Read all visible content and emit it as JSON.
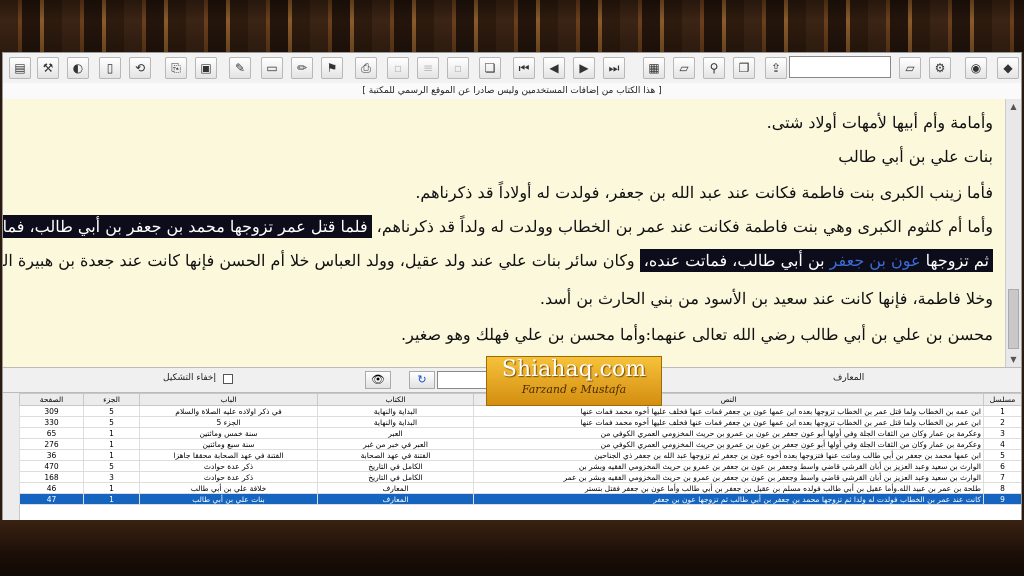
{
  "notice": "[ هذا الكتاب من إضافات المستخدمين وليس صادرا عن الموقع الرسمي للمكتبة ]",
  "toolbar": {
    "icons": [
      "app-icon",
      "tools-icon",
      "eraser-icon",
      "page-icon",
      "refresh-icon",
      "copy-icon",
      "paste-icon",
      "edit-icon",
      "note-icon",
      "pencil-icon",
      "tag-icon",
      "print-icon",
      "disabled-icon-1",
      "disabled-icon-2",
      "disabled-icon-3",
      "book-icon",
      "first-icon",
      "prev-icon",
      "next-icon",
      "last-icon",
      "grid-icon",
      "folder-icon",
      "binoculars-icon",
      "bookmark-icon",
      "export-icon"
    ],
    "search_value": "",
    "right_icons": [
      "open-folder-icon",
      "settings-icon",
      "eye-icon",
      "book-open-icon"
    ]
  },
  "reader": {
    "lines": [
      {
        "type": "plain",
        "text": "وأمامة وأم أبيها لأمهات أولاد شتى."
      },
      {
        "type": "heading",
        "text": "بنات علي بن أبي طالب"
      },
      {
        "type": "plain",
        "text": "فأما زينب الكبرى بنت فاطمة فكانت عند عبد الله بن جعفر، فولدت له أولاداً قد ذكرناهم."
      },
      {
        "type": "mixed",
        "pre": "وأما أم كلثوم الكبرى وهي بنت فاطمة فكانت عند عمر بن الخطاب وولدت له ولداً قد ذكرناهم، ",
        "hl": "فلما قتل عمر تزوجها محمد بن جعفر بن أبي طالب، فمات عنها"
      },
      {
        "type": "mixed2",
        "hl_pre": "ثم تزوجها ",
        "hl_blue": "عون بن جعفر",
        "hl_post": " بن أبي طالب، فماتت عنده،",
        "post": " وكان سائر بنات علي عند ولد عقيل، وولد العباس خلا أم الحسن فإنها كانت عند جعدة بن هبيرة المخزومي"
      },
      {
        "type": "plain",
        "text": "وخلا فاطمة، فإنها كانت عند سعيد بن الأسود من بني الحارث بن أسد."
      },
      {
        "type": "plain",
        "text": "محسن بن علي بن أبي طالب رضي الله تعالى عنهما:وأما محسن بن علي فهلك وهو صغير."
      }
    ]
  },
  "searchbar": {
    "hide_diacritics_label": "إخفاء التشكيل",
    "book_label": "المعارف"
  },
  "logo": {
    "line1": "Shiahaq.com",
    "line2": "Farzand e Mustafa"
  },
  "table": {
    "headers": [
      "الصفحة",
      "الجزء",
      "الباب",
      "الكتاب",
      "النص",
      "مسلسل"
    ],
    "rows": [
      [
        "309",
        "5",
        "في ذكر اولاده عليه الصلاة والسلام",
        "البداية والنهاية",
        "ابن عمه بن الخطاب ولما قتل عمر بن الخطاب تزوجها بعده ابن عمها عون بن جعفر فمات عنها فخلف عليها أخوه محمد فمات عنها",
        "1"
      ],
      [
        "330",
        "5",
        "الجزء 5",
        "البداية والنهاية",
        "ابن عمر بن الخطاب ولما قتل عمر بن الخطاب تزوجها بعده ابن عمها عون بن جعفر فمات عنها فخلف عليها أخوه محمد فمات عنها",
        "2"
      ],
      [
        "65",
        "1",
        "سنة خمس ومائتين",
        "العبر",
        "وعكرمة بن عمار وكان من الثقات الجلة وفي أولها أبو عون جعفر بن عون بن عمرو بن حريث المخزومي العمري الكوفي من",
        "3"
      ],
      [
        "276",
        "1",
        "سنة سبع ومائتين",
        "العبر في خبر من غبر",
        "وعكرمة بن عمار وكان من الثقات الجلة وفي أولها أبو عون جعفر بن عون بن عمرو بن حريث المخزومي العمري الكوفي من",
        "4"
      ],
      [
        "36",
        "1",
        "الفتنة في عهد الصحابة محققا جاهزا",
        "الفتنة في عهد الصحابة",
        "ابن عمها محمد بن جعفر بن أبي طالب وماتت عنها فتزوجها بعده أخوه عون بن جعفر ثم تزوجها عبد الله بن جعفر ذي الجناحين",
        "5"
      ],
      [
        "470",
        "5",
        "ذكر عدة حوادث",
        "الكامل في التاريخ",
        "الوارث بن سعيد وعبد العزيز بن أبان القرشي قاضي واسط وجعفر بن عون بن جعفر بن عمرو بن حريث المخزومي الفقيه وبشر بن",
        "6"
      ],
      [
        "168",
        "3",
        "ذكر عدة حوادث",
        "الكامل في التاريخ",
        "الوارث بن سعيد وعبد العزيز بن أبان القرشي قاضي واسط وجعفر بن عون بن جعفر بن عمرو بن حريث المخزومي الفقيه وبشر بن عمر",
        "7"
      ],
      [
        "46",
        "1",
        "خلافة علي بن أبي طالب",
        "المعارف",
        "طلحة بن عمر بن عبيد الله.وأما عقيل بن أبي طالب فولده مسلم بن عقيل بن جعفر بن أبي طالب وأما عون بن جعفر فقتل بتستر",
        "8"
      ],
      [
        "47",
        "1",
        "بنات علي بن أبي طالب",
        "المعارف",
        "كانت عند عمر بن الخطاب فولدت له ولدا ثم تزوجها محمد بن جعفر بن أبي طالب ثم تزوجها عون بن جعفر",
        "9"
      ]
    ],
    "selected_row": 8
  }
}
